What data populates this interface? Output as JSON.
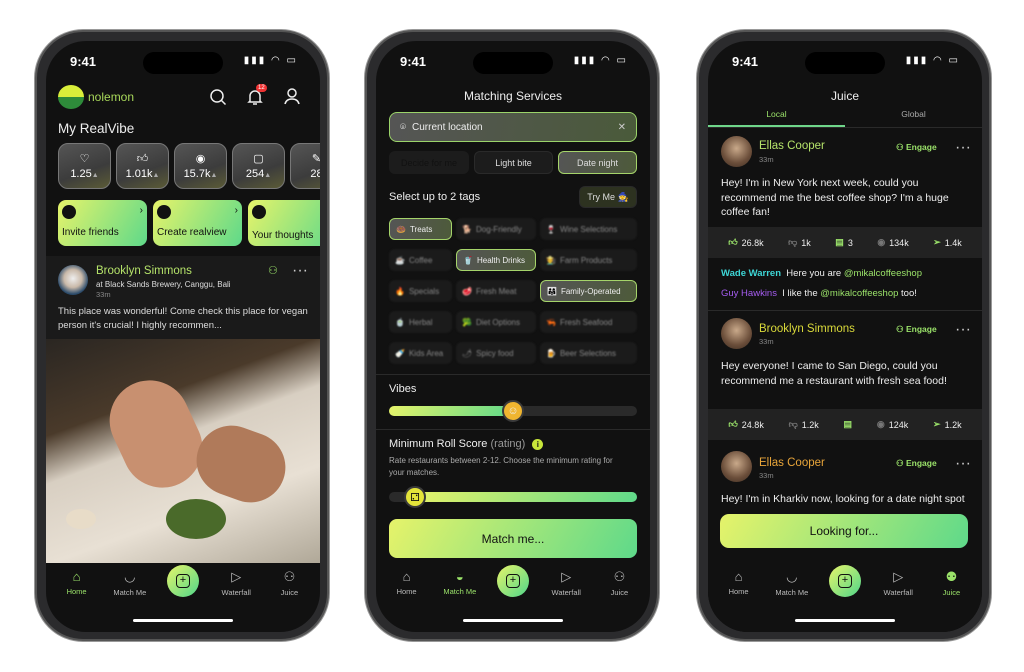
{
  "status": {
    "time": "9:41"
  },
  "home": {
    "logo_text": "nolemon",
    "notification_count": "12",
    "section_title": "My RealVibe",
    "stats": [
      {
        "icon": "heart-icon",
        "value": "1.25"
      },
      {
        "icon": "thumbs-up-icon",
        "value": "1.01k"
      },
      {
        "icon": "eye-icon",
        "value": "15.7k"
      },
      {
        "icon": "chat-icon",
        "value": "254"
      },
      {
        "icon": "edit-icon",
        "value": "28"
      }
    ],
    "actions": [
      {
        "label": "Invite friends"
      },
      {
        "label": "Create realview"
      },
      {
        "label": "Your thoughts"
      }
    ],
    "post": {
      "author": "Brooklyn Simmons",
      "location": "at Black Sands Brewery, Canggu, Bali",
      "time": "33m",
      "text": "This place was wonderful! Come check this place for vegan person it's crucial! I highly recommen..."
    }
  },
  "nav": {
    "home": "Home",
    "match": "Match Me",
    "waterfall": "Waterfall",
    "juice": "Juice"
  },
  "match": {
    "title": "Matching Services",
    "location_placeholder": "Current location",
    "modes": [
      {
        "label": "Decide for me",
        "state": "active"
      },
      {
        "label": "Light bite",
        "state": "default"
      },
      {
        "label": "Date night",
        "state": "selected"
      }
    ],
    "tags_title": "Select up to 2 tags",
    "try_me": "Try Me",
    "tags": [
      {
        "label": "Treats",
        "emoji": "🍩",
        "selected": true
      },
      {
        "label": "Dog-Friendly",
        "emoji": "🐕",
        "selected": false
      },
      {
        "label": "Wine Selections",
        "emoji": "🍷",
        "selected": false
      },
      {
        "label": "Coffee",
        "emoji": "☕",
        "selected": false
      },
      {
        "label": "Health Drinks",
        "emoji": "🥤",
        "selected": true
      },
      {
        "label": "Farm Products",
        "emoji": "🧑‍🌾",
        "selected": false
      },
      {
        "label": "Specials",
        "emoji": "🔥",
        "selected": false
      },
      {
        "label": "Fresh Meat",
        "emoji": "🥩",
        "selected": false
      },
      {
        "label": "Family-Operated",
        "emoji": "👨‍👩‍👧",
        "selected": true
      },
      {
        "label": "Herbal",
        "emoji": "🍵",
        "selected": false
      },
      {
        "label": "Diet Options",
        "emoji": "🥦",
        "selected": false
      },
      {
        "label": "Fresh Seafood",
        "emoji": "🦐",
        "selected": false
      },
      {
        "label": "Kids Area",
        "emoji": "🍼",
        "selected": false
      },
      {
        "label": "Spicy food",
        "emoji": "🌶",
        "selected": false
      },
      {
        "label": "Beer Selections",
        "emoji": "🍺",
        "selected": false
      }
    ],
    "vibes_label": "Vibes",
    "vibes_value": 0.5,
    "roll_label": "Minimum Roll Score",
    "roll_sub": "(rating)",
    "roll_desc": "Rate restaurants between 2-12. Choose the minimum rating for your matches.",
    "roll_value": 2,
    "match_button": "Match me..."
  },
  "juice": {
    "title": "Juice",
    "tabs": [
      {
        "label": "Local",
        "active": true
      },
      {
        "label": "Global",
        "active": false
      }
    ],
    "engage": "Engage",
    "posts": [
      {
        "author": "Ellas Cooper",
        "author_color": "#b5e36a",
        "time": "33m",
        "text": "Hey! I'm in New York next week, could you recommend me the best coffee shop? I'm a huge coffee fan!",
        "likes": "26.8k",
        "dislikes": "1k",
        "comments": "3",
        "views": "134k",
        "shares": "1.4k"
      },
      {
        "author": "Brooklyn Simmons",
        "author_color": "#d9d93a",
        "time": "33m",
        "text": "Hey everyone! I came to San Diego, could you recommend me a restaurant with fresh sea food!",
        "likes": "24.8k",
        "dislikes": "1.2k",
        "comments": "",
        "views": "124k",
        "shares": "1.2k"
      },
      {
        "author": "Ellas Cooper",
        "author_color": "#e8a53a",
        "time": "33m",
        "text": "Hey! I'm in Kharkiv now, looking for a date night spot"
      }
    ],
    "comments": [
      {
        "user": "Wade Warren",
        "user_color": "#3ed6d6",
        "text": "Here you are",
        "mention": "@mikalcoffeeshop",
        "after": ""
      },
      {
        "user": "Guy Hawkins",
        "user_color": "#a55cf0",
        "text": "I like the",
        "mention": "@mikalcoffeeshop",
        "after": "too!"
      }
    ],
    "looking_button": "Looking for..."
  }
}
